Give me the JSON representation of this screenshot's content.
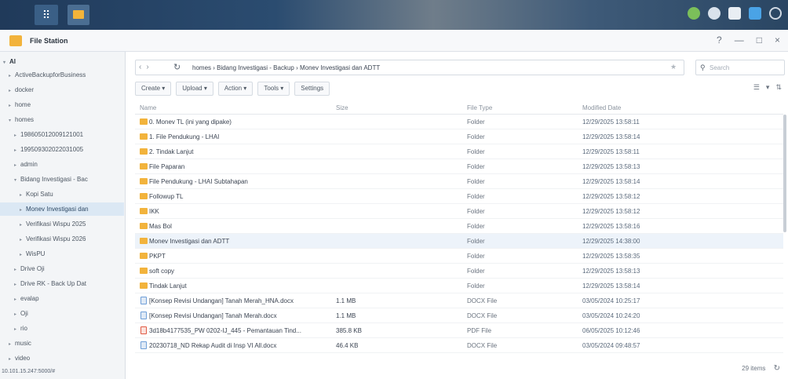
{
  "window": {
    "title": "File Station",
    "controls": [
      "?",
      "—",
      "□",
      "×"
    ]
  },
  "sidebar": {
    "root": "AI",
    "items": [
      {
        "label": "ActiveBackupforBusiness",
        "arrow": "▸",
        "indent": 1
      },
      {
        "label": "docker",
        "arrow": "▸",
        "indent": 1
      },
      {
        "label": "home",
        "arrow": "▸",
        "indent": 1
      },
      {
        "label": "homes",
        "arrow": "▾",
        "indent": 1
      },
      {
        "label": "198605012009121001",
        "arrow": "▸",
        "indent": 2
      },
      {
        "label": "199509302022031005",
        "arrow": "▸",
        "indent": 2
      },
      {
        "label": "admin",
        "arrow": "▸",
        "indent": 2
      },
      {
        "label": "Bidang Investigasi - Bac",
        "arrow": "▾",
        "indent": 2
      },
      {
        "label": "Kopi Satu",
        "arrow": "▸",
        "indent": 3
      },
      {
        "label": "Monev Investigasi dan",
        "arrow": "▸",
        "indent": 3,
        "selected": true
      },
      {
        "label": "Verifikasi Wispu 2025",
        "arrow": "▸",
        "indent": 3
      },
      {
        "label": "Verifikasi Wispu 2026",
        "arrow": "▸",
        "indent": 3
      },
      {
        "label": "WisPU",
        "arrow": "▸",
        "indent": 3
      },
      {
        "label": "Drive Oji",
        "arrow": "▸",
        "indent": 2
      },
      {
        "label": "Drive RK - Back Up Dat",
        "arrow": "▸",
        "indent": 2
      },
      {
        "label": "evalap",
        "arrow": "▸",
        "indent": 2
      },
      {
        "label": "Oji",
        "arrow": "▸",
        "indent": 2
      },
      {
        "label": "rio",
        "arrow": "▸",
        "indent": 2
      },
      {
        "label": "music",
        "arrow": "▸",
        "indent": 1
      },
      {
        "label": "video",
        "arrow": "▸",
        "indent": 1
      }
    ],
    "url": "10.101.15.247:5000/#"
  },
  "pathbar": {
    "path": "homes › Bidang Investigasi - Backup › Monev Investigasi dan ADTT"
  },
  "search": {
    "placeholder": "Search"
  },
  "toolbar": {
    "create": "Create ▾",
    "upload": "Upload ▾",
    "action": "Action ▾",
    "tools": "Tools ▾",
    "settings": "Settings"
  },
  "table": {
    "headers": {
      "name": "Name",
      "size": "Size",
      "type": "File Type",
      "date": "Modified Date"
    },
    "rows": [
      {
        "name": "0. Monev TL (ini yang dipake)",
        "size": "",
        "type": "Folder",
        "date": "12/29/2025 13:58:11",
        "icon": "folder"
      },
      {
        "name": "1. File Pendukung - LHAI",
        "size": "",
        "type": "Folder",
        "date": "12/29/2025 13:58:14",
        "icon": "folder"
      },
      {
        "name": "2. Tindak Lanjut",
        "size": "",
        "type": "Folder",
        "date": "12/29/2025 13:58:11",
        "icon": "folder"
      },
      {
        "name": "File Paparan",
        "size": "",
        "type": "Folder",
        "date": "12/29/2025 13:58:13",
        "icon": "folder"
      },
      {
        "name": "File Pendukung - LHAI Subtahapan",
        "size": "",
        "type": "Folder",
        "date": "12/29/2025 13:58:14",
        "icon": "folder"
      },
      {
        "name": "Followup TL",
        "size": "",
        "type": "Folder",
        "date": "12/29/2025 13:58:12",
        "icon": "folder"
      },
      {
        "name": "IKK",
        "size": "",
        "type": "Folder",
        "date": "12/29/2025 13:58:12",
        "icon": "folder"
      },
      {
        "name": "Mas Bol",
        "size": "",
        "type": "Folder",
        "date": "12/29/2025 13:58:16",
        "icon": "folder"
      },
      {
        "name": "Monev Investigasi dan ADTT",
        "size": "",
        "type": "Folder",
        "date": "12/29/2025 14:38:00",
        "icon": "folder",
        "highlight": true
      },
      {
        "name": "PKPT",
        "size": "",
        "type": "Folder",
        "date": "12/29/2025 13:58:35",
        "icon": "folder"
      },
      {
        "name": "soft copy",
        "size": "",
        "type": "Folder",
        "date": "12/29/2025 13:58:13",
        "icon": "folder"
      },
      {
        "name": "Tindak Lanjut",
        "size": "",
        "type": "Folder",
        "date": "12/29/2025 13:58:14",
        "icon": "folder"
      },
      {
        "name": "[Konsep Revisi Undangan] Tanah Merah_HNA.docx",
        "size": "1.1 MB",
        "type": "DOCX File",
        "date": "03/05/2024 10:25:17",
        "icon": "docx"
      },
      {
        "name": "[Konsep Revisi Undangan] Tanah Merah.docx",
        "size": "1.1 MB",
        "type": "DOCX File",
        "date": "03/05/2024 10:24:20",
        "icon": "docx"
      },
      {
        "name": "3d18b4177535_PW 0202-IJ_445 - Pemantauan Tind...",
        "size": "385.8 KB",
        "type": "PDF File",
        "date": "06/05/2025 10:12:46",
        "icon": "pdf"
      },
      {
        "name": "20230718_ND Rekap Audit di Insp VI All.docx",
        "size": "46.4 KB",
        "type": "DOCX File",
        "date": "03/05/2024 09:48:57",
        "icon": "docx"
      }
    ]
  },
  "status": {
    "count": "29 items"
  },
  "colors": {
    "folder": "#f2b33c",
    "accent": "#dbe8f4"
  }
}
